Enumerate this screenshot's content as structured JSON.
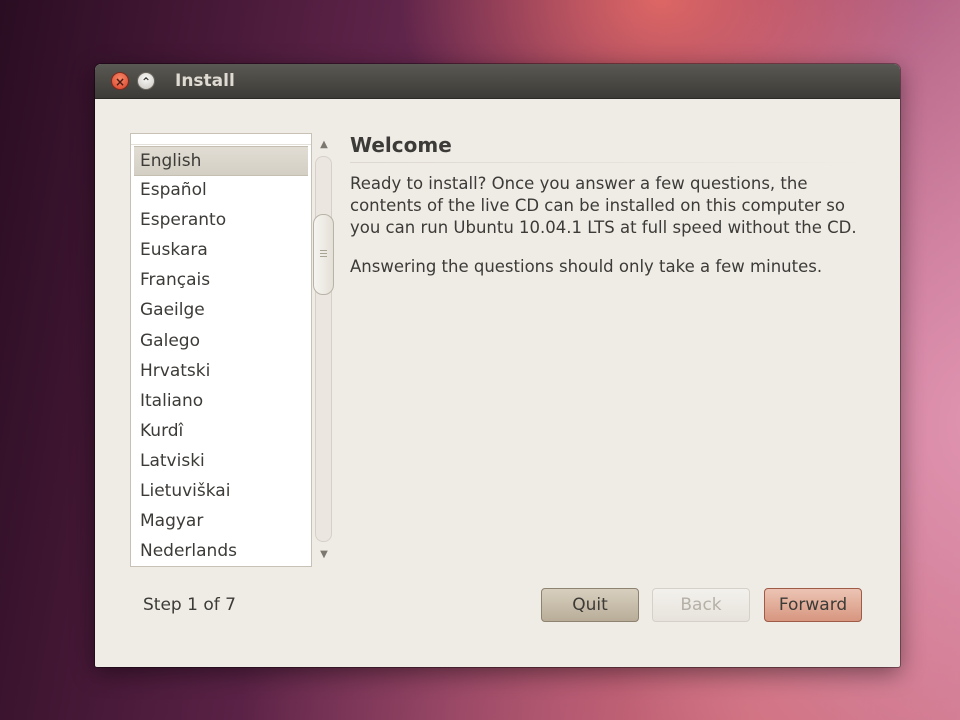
{
  "window": {
    "title": "Install",
    "close_glyph": "×",
    "minimize_glyph": "⌃"
  },
  "languages": {
    "items": [
      {
        "label": "English"
      },
      {
        "label": "Español"
      },
      {
        "label": "Esperanto"
      },
      {
        "label": "Euskara"
      },
      {
        "label": "Français"
      },
      {
        "label": "Gaeilge"
      },
      {
        "label": "Galego"
      },
      {
        "label": "Hrvatski"
      },
      {
        "label": "Italiano"
      },
      {
        "label": "Kurdî"
      },
      {
        "label": "Latviski"
      },
      {
        "label": "Lietuviškai"
      },
      {
        "label": "Magyar"
      },
      {
        "label": "Nederlands"
      }
    ],
    "selected": "English",
    "scroll_up_glyph": "▲",
    "scroll_down_glyph": "▼"
  },
  "content": {
    "heading": "Welcome",
    "paragraph1": "Ready to install?  Once you answer a few questions, the contents of the live CD can be installed on this computer so you can run Ubuntu 10.04.1 LTS at full speed without the CD.",
    "paragraph2": "Answering the questions should only take a few minutes."
  },
  "footer": {
    "step_label": "Step 1 of 7",
    "quit_label": "Quit",
    "back_label": "Back",
    "forward_label": "Forward"
  },
  "icons": {
    "close": "close-icon",
    "minimize": "minimize-icon",
    "scroll_up": "arrow-up-icon",
    "scroll_down": "arrow-down-icon"
  },
  "colors": {
    "window_background": "#efebe5",
    "titlebar": "#3c3b37",
    "close_button": "#d9432a",
    "forward_button": "#d7967f",
    "quit_button": "#b9ad98",
    "text": "#3c3b37"
  }
}
